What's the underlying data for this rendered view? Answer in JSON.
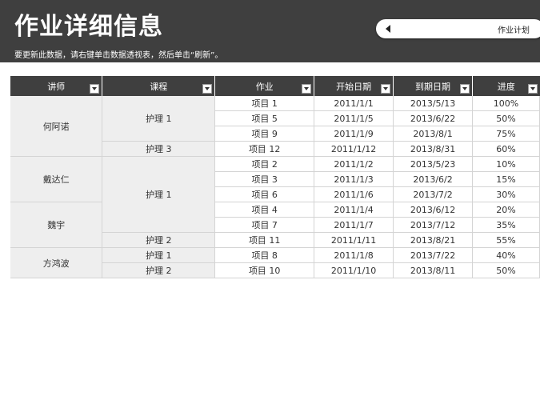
{
  "header": {
    "title": "作业详细信息",
    "subtitle": "要更新此数据，请右键单击数据透视表，然后单击“刷新”。",
    "nav_button": "作业计划"
  },
  "table": {
    "columns": [
      "讲师",
      "课程",
      "作业",
      "开始日期",
      "到期日期",
      "进度"
    ],
    "instructors": [
      {
        "name": "何阿诺",
        "courses": [
          {
            "name": "护理 1",
            "rows": [
              {
                "task": "项目 1",
                "start": "2011/1/1",
                "due": "2013/5/13",
                "progress": "100%"
              },
              {
                "task": "项目 5",
                "start": "2011/1/5",
                "due": "2013/6/22",
                "progress": "50%"
              },
              {
                "task": "项目 9",
                "start": "2011/1/9",
                "due": "2013/8/1",
                "progress": "75%"
              }
            ]
          },
          {
            "name": "护理 3",
            "rows": [
              {
                "task": "项目 12",
                "start": "2011/1/12",
                "due": "2013/8/31",
                "progress": "60%"
              }
            ]
          }
        ]
      },
      {
        "name": "戴达仁",
        "courses": [
          {
            "name": "护理 1",
            "rows": [
              {
                "task": "项目 2",
                "start": "2011/1/2",
                "due": "2013/5/23",
                "progress": "10%"
              },
              {
                "task": "项目 3",
                "start": "2011/1/3",
                "due": "2013/6/2",
                "progress": "15%"
              },
              {
                "task": "项目 6",
                "start": "2011/1/6",
                "due": "2013/7/2",
                "progress": "30%"
              }
            ]
          }
        ]
      },
      {
        "name": "魏宇",
        "courses": [
          {
            "name": "",
            "rows": [
              {
                "task": "项目 4",
                "start": "2011/1/4",
                "due": "2013/6/12",
                "progress": "20%"
              },
              {
                "task": "项目 7",
                "start": "2011/1/7",
                "due": "2013/7/12",
                "progress": "35%"
              }
            ]
          },
          {
            "name": "护理 2",
            "rows": [
              {
                "task": "项目 11",
                "start": "2011/1/11",
                "due": "2013/8/21",
                "progress": "55%"
              }
            ]
          }
        ]
      },
      {
        "name": "方鸿波",
        "courses": [
          {
            "name": "护理 1",
            "rows": [
              {
                "task": "项目 8",
                "start": "2011/1/8",
                "due": "2013/7/22",
                "progress": "40%"
              }
            ]
          },
          {
            "name": "护理 2",
            "rows": [
              {
                "task": "项目 10",
                "start": "2011/1/10",
                "due": "2013/8/11",
                "progress": "50%"
              }
            ]
          }
        ]
      }
    ]
  }
}
